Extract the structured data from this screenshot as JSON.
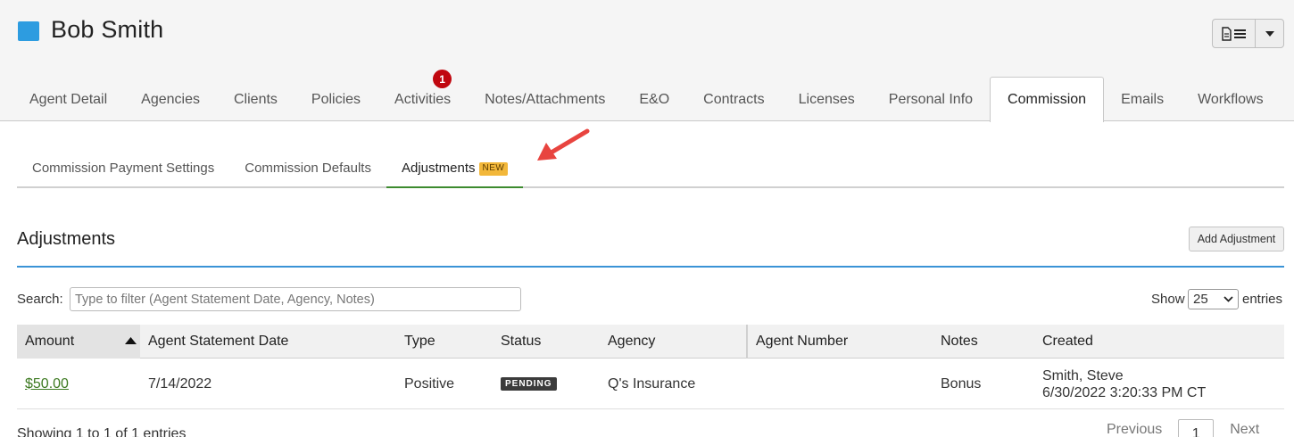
{
  "header": {
    "agent_name": "Bob Smith",
    "accent_color": "#2d9ce0",
    "menu_icon": "document-list-icon",
    "caret_icon": "caret-down-icon"
  },
  "main_tabs": [
    {
      "label": "Agent Detail"
    },
    {
      "label": "Agencies"
    },
    {
      "label": "Clients"
    },
    {
      "label": "Policies"
    },
    {
      "label": "Activities",
      "badge": "1"
    },
    {
      "label": "Notes/Attachments"
    },
    {
      "label": "E&O"
    },
    {
      "label": "Contracts"
    },
    {
      "label": "Licenses"
    },
    {
      "label": "Personal Info"
    },
    {
      "label": "Commission",
      "active": true
    },
    {
      "label": "Emails"
    },
    {
      "label": "Workflows"
    }
  ],
  "sub_tabs": [
    {
      "label": "Commission Payment Settings"
    },
    {
      "label": "Commission Defaults"
    },
    {
      "label": "Adjustments",
      "badge": "NEW",
      "active": true
    }
  ],
  "section": {
    "title": "Adjustments",
    "add_button": "Add Adjustment"
  },
  "search": {
    "label": "Search:",
    "placeholder": "Type to filter (Agent Statement Date, Agency, Notes)"
  },
  "entries": {
    "show_label": "Show",
    "value": "25",
    "suffix": "entries"
  },
  "table": {
    "columns": [
      "Amount",
      "Agent Statement Date",
      "Type",
      "Status",
      "Agency",
      "Agent Number",
      "Notes",
      "Created"
    ],
    "rows": [
      {
        "amount": "$50.00",
        "statement_date": "7/14/2022",
        "type": "Positive",
        "status": "PENDING",
        "agency": "Q's Insurance",
        "agent_number": "",
        "notes": "Bonus",
        "created_by": "Smith, Steve",
        "created_at": "6/30/2022 3:20:33 PM CT"
      }
    ]
  },
  "footer": {
    "showing": "Showing 1 to 1 of 1 entries",
    "previous": "Previous",
    "page": "1",
    "next": "Next"
  }
}
